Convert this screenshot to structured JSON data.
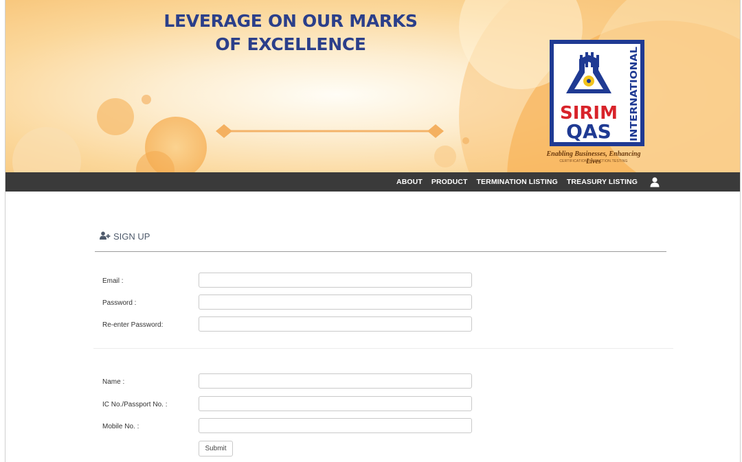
{
  "banner": {
    "headline_line1": "LEVERAGE ON OUR MARKS",
    "headline_line2": "OF EXCELLENCE",
    "logo_text_1": "SIRIM",
    "logo_text_2": "QAS",
    "logo_vertical": "INTERNATIONAL",
    "tagline": "Enabling Businesses, Enhancing Lives",
    "tagline_sub": "CERTIFICATION.INSPECTION.TESTING"
  },
  "nav": {
    "items": [
      "ABOUT",
      "PRODUCT",
      "TERMINATION LISTING",
      "TREASURY LISTING"
    ],
    "user_icon": "user-icon"
  },
  "signup": {
    "title": "SIGN UP",
    "icon": "add-user-icon",
    "fields_account": [
      {
        "label": "Email :",
        "value": ""
      },
      {
        "label": "Password :",
        "value": ""
      },
      {
        "label": "Re-enter Password:",
        "value": ""
      }
    ],
    "fields_personal": [
      {
        "label": "Name :",
        "value": ""
      },
      {
        "label": "IC No./Passport No. :",
        "value": ""
      },
      {
        "label": "Mobile No. :",
        "value": ""
      }
    ],
    "submit_label": "Submit"
  },
  "colors": {
    "headline": "#2b3f8a",
    "navbar": "#3a3a3a",
    "banner_orange": "#f7a23a",
    "logo_blue": "#1f3a93"
  }
}
